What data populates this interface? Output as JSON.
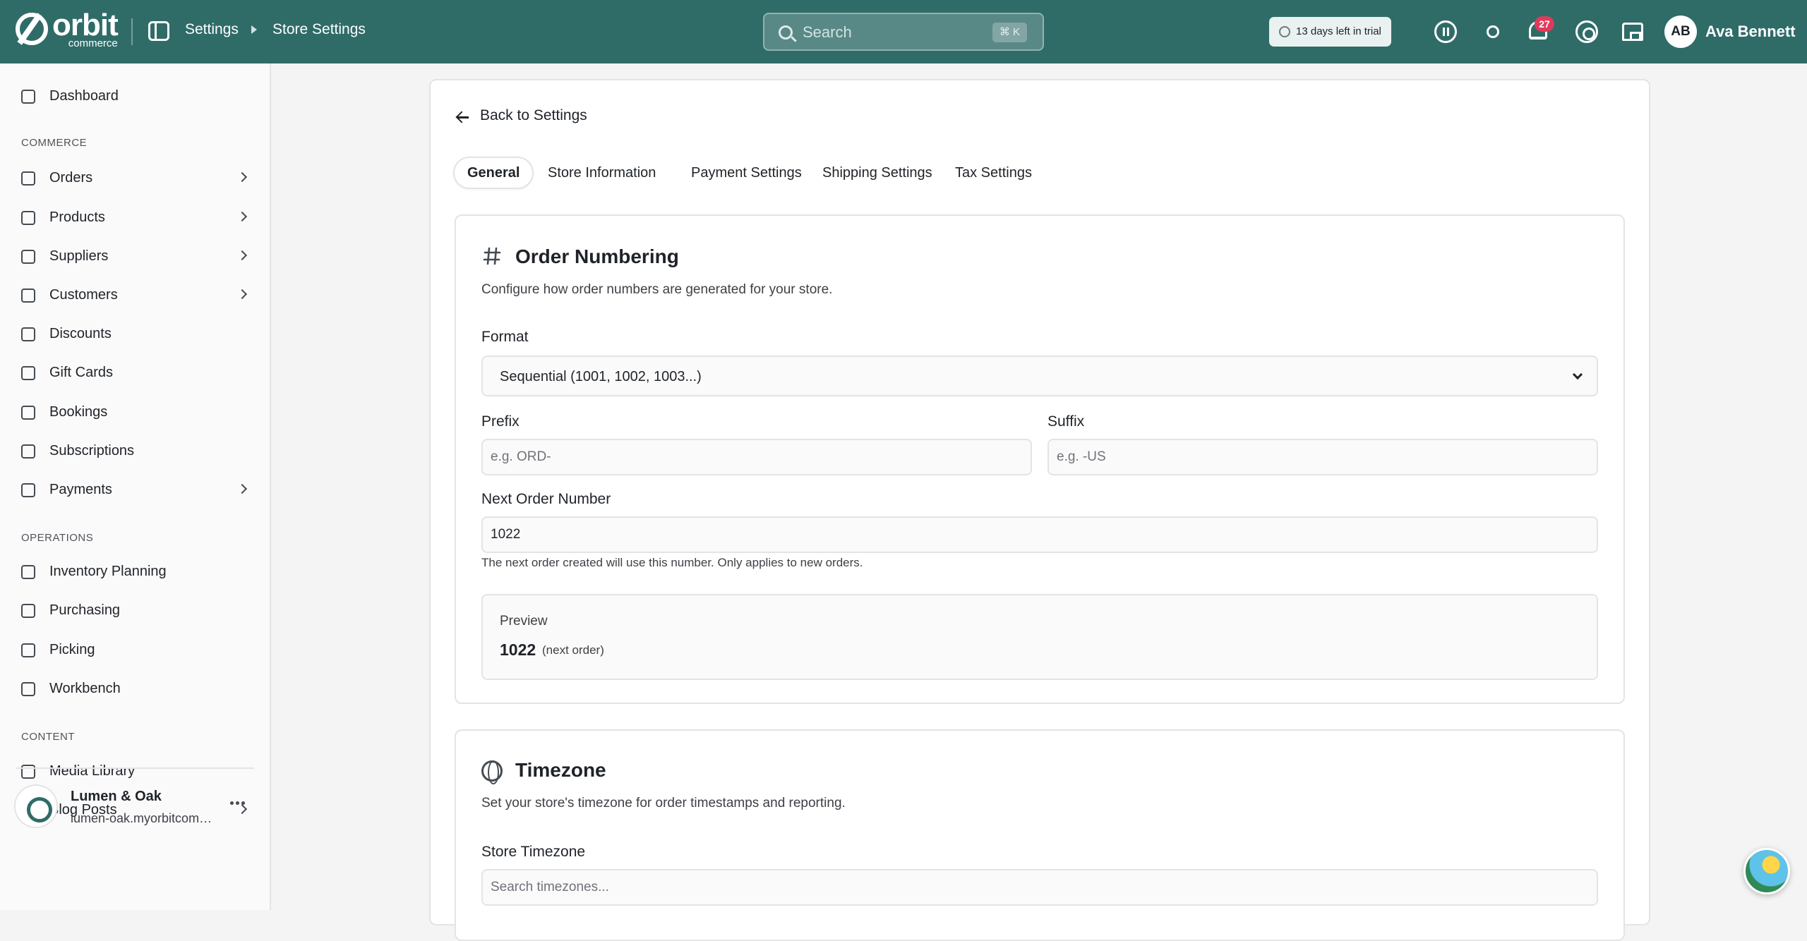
{
  "app": {
    "brand": "orbit",
    "brand_sub": "commerce",
    "colors": {
      "topbar": "#2f6c68",
      "notification_badge": "#e03a5b"
    }
  },
  "header": {
    "breadcrumb": [
      "Settings",
      "Store Settings"
    ],
    "search_placeholder": "Search",
    "search_shortcut": "⌘ K",
    "trial": "13 days left in trial",
    "notifications_count": "27",
    "user_initials": "AB",
    "user_name": "Ava Bennett",
    "icons": [
      "pause-icon",
      "sun-icon",
      "bell-icon",
      "help-icon",
      "store-icon"
    ]
  },
  "sidebar": {
    "top_item": "Dashboard",
    "sections": [
      {
        "title": "COMMERCE",
        "items": [
          "Orders",
          "Products",
          "Suppliers",
          "Customers",
          "Discounts",
          "Gift Cards",
          "Bookings",
          "Subscriptions",
          "Payments"
        ]
      },
      {
        "title": "OPERATIONS",
        "items": [
          "Inventory Planning",
          "Purchasing",
          "Picking",
          "Workbench"
        ]
      },
      {
        "title": "CONTENT",
        "items": [
          "Media Library",
          "Blog Posts"
        ]
      }
    ],
    "workspace": {
      "name": "Lumen & Oak",
      "url": "lumen-oak.myorbitcommerce.com"
    }
  },
  "main": {
    "back_label": "Back to Settings",
    "tabs": [
      "General",
      "Store Information",
      "Payment Settings",
      "Shipping Settings",
      "Tax Settings"
    ],
    "active_tab": "General",
    "order_numbering": {
      "title": "Order Numbering",
      "description": "Configure how order numbers are generated for your store.",
      "format_label": "Format",
      "format_value": "Sequential (1001, 1002, 1003...)",
      "prefix_label": "Prefix",
      "prefix_placeholder": "e.g. ORD-",
      "suffix_label": "Suffix",
      "suffix_placeholder": "e.g. -US",
      "next_label": "Next Order Number",
      "next_value": "1022",
      "next_hint": "The next order created will use this number. Only applies to new orders.",
      "preview_label": "Preview",
      "preview_value": "1022",
      "preview_note": "(next order)"
    },
    "timezone": {
      "title": "Timezone",
      "description": "Set your store's timezone for order timestamps and reporting.",
      "field_label": "Store Timezone",
      "field_placeholder": "Search timezones..."
    }
  }
}
